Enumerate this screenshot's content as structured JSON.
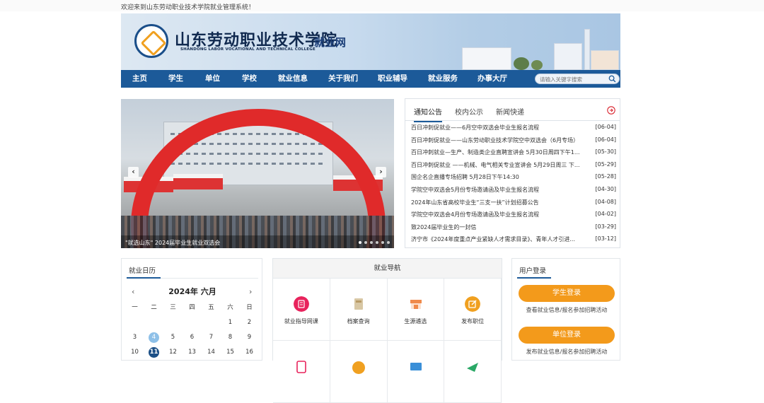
{
  "topbar": {
    "welcome": "欢迎来到山东劳动职业技术学院就业管理系统！"
  },
  "header": {
    "school_name": "山东劳动职业技术学院",
    "school_en": "SHANDONG LABOR VOCATIONAL AND TECHNICAL COLLEGE",
    "site_name": "就业网"
  },
  "nav": {
    "items": [
      "主页",
      "学生",
      "单位",
      "学校",
      "就业信息",
      "关于我们",
      "职业辅导",
      "就业服务",
      "办事大厅"
    ],
    "search_placeholder": "请输入关键字搜索"
  },
  "slider": {
    "caption": "\"就选山东\" 2024届毕业生就业双选会",
    "prev_label": "‹",
    "next_label": "›",
    "dot_count": 6,
    "active_dot": 0
  },
  "news": {
    "tabs": [
      "通知公告",
      "校内公示",
      "新闻快递"
    ],
    "active_tab": 0,
    "items": [
      {
        "title": "百日冲刺促就业——6月空中双选会毕业生报名流程",
        "date": "[06-04]"
      },
      {
        "title": "百日冲刺促就业——山东劳动职业技术学院空中双选会（6月专场）",
        "date": "[06-04]"
      },
      {
        "title": "百日冲刺就业—生产、制造类企业直聘宣讲会 5月30日周四下午1...",
        "date": "[05-30]"
      },
      {
        "title": "百日冲刺促就业 ——机械、电气相关专业宣讲会 5月29日周三 下...",
        "date": "[05-29]"
      },
      {
        "title": "国企名企直播专场招聘 5月28日下午14:30",
        "date": "[05-28]"
      },
      {
        "title": "学院空中双选会5月份专场邀请函及毕业生报名流程",
        "date": "[04-30]"
      },
      {
        "title": "2024年山东省高校毕业生“三支一扶”计划招募公告",
        "date": "[04-08]"
      },
      {
        "title": "学院空中双选会4月份专场邀请函及毕业生报名流程",
        "date": "[04-02]"
      },
      {
        "title": "致2024届毕业生的一封信",
        "date": "[03-29]"
      },
      {
        "title": "济宁市《2024年度重点产业紧缺人才需求目录》、青年人才引进...",
        "date": "[03-12]"
      }
    ]
  },
  "calendar": {
    "title": "就业日历",
    "month_label": "2024年 六月",
    "prev": "‹",
    "next": "›",
    "weekdays": [
      "一",
      "二",
      "三",
      "四",
      "五",
      "六",
      "日"
    ],
    "days": [
      "",
      "",
      "",
      "",
      "",
      "1",
      "2",
      "3",
      "4",
      "5",
      "6",
      "7",
      "8",
      "9",
      "10",
      "11",
      "12",
      "13",
      "14",
      "15",
      "16"
    ],
    "today": "4",
    "selected": "11"
  },
  "guide": {
    "title": "就业导航",
    "items": [
      {
        "label": "就业指导网课",
        "icon": "online-course-icon",
        "color": "#e8235c"
      },
      {
        "label": "档案查询",
        "icon": "archive-icon",
        "color": "#d8c7a4"
      },
      {
        "label": "生源遴选",
        "icon": "store-icon",
        "color": "#f08a4b"
      },
      {
        "label": "发布职位",
        "icon": "edit-icon",
        "color": "#f0a020"
      },
      {
        "label": "",
        "icon": "document-icon",
        "color": "#e8235c"
      },
      {
        "label": "",
        "icon": "circle-icon",
        "color": "#f0a020"
      },
      {
        "label": "",
        "icon": "monitor-icon",
        "color": "#3a8fd8"
      },
      {
        "label": "",
        "icon": "send-icon",
        "color": "#2aa866"
      }
    ]
  },
  "login": {
    "title": "用户登录",
    "student_button": "学生登录",
    "student_sub": "查看就业信息/报名参加招聘活动",
    "company_button": "单位登录",
    "company_sub": "发布就业信息/报名参加招聘活动",
    "button_color": "#f39a1b"
  }
}
